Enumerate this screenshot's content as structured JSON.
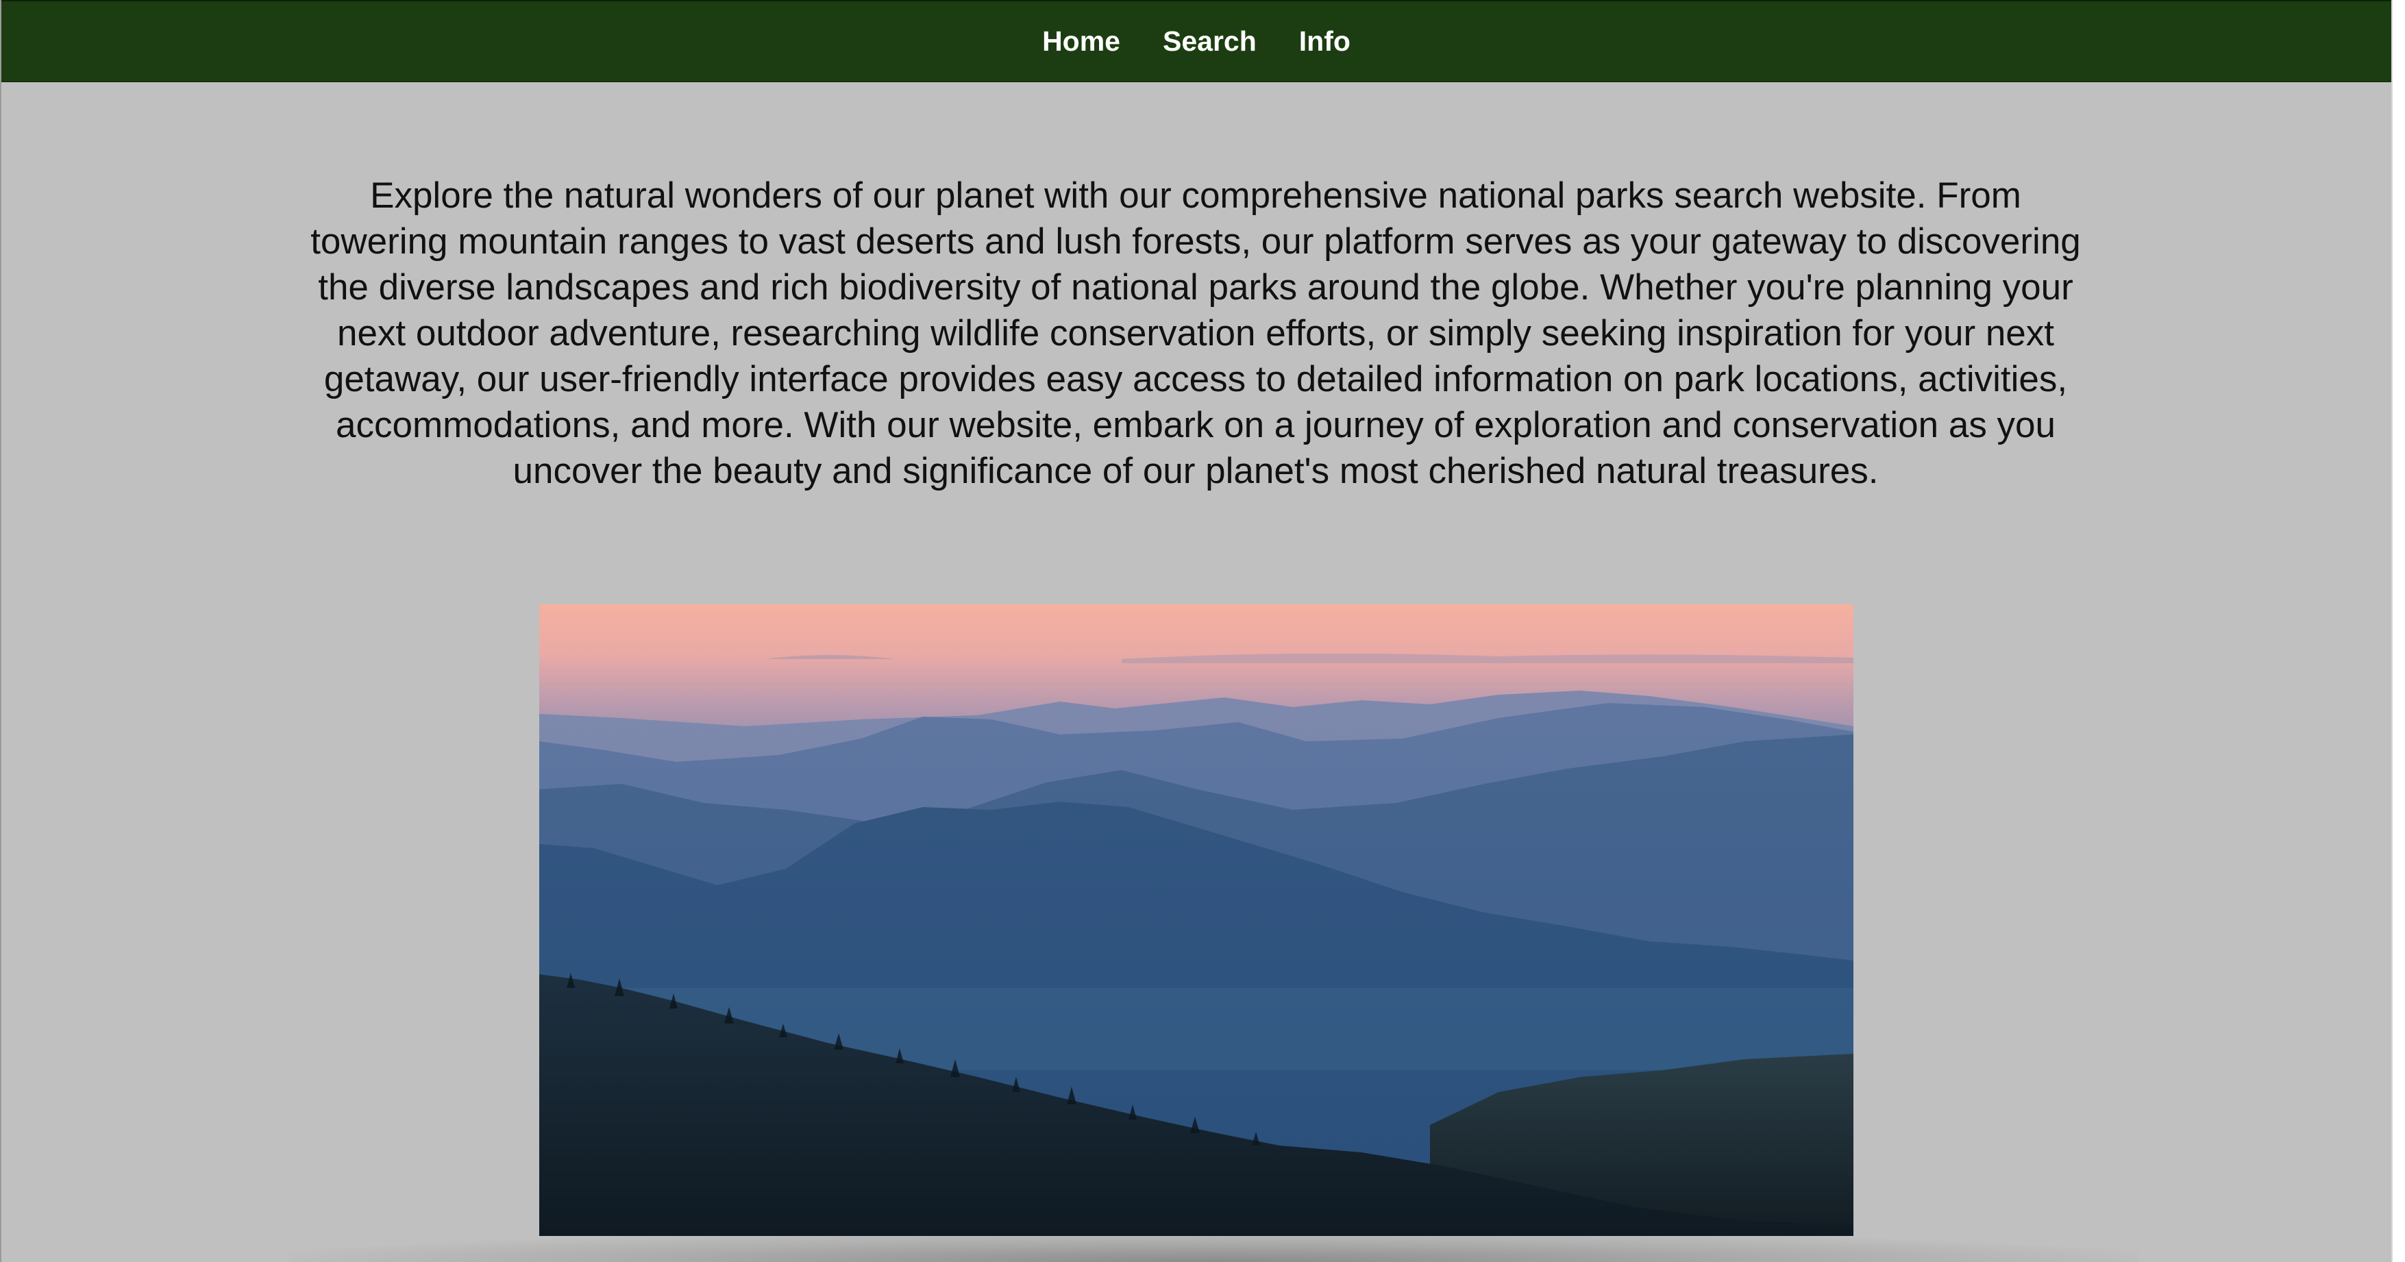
{
  "nav": {
    "links": [
      "Home",
      "Search",
      "Info"
    ]
  },
  "intro": {
    "text": "Explore the natural wonders of our planet with our comprehensive national parks search website. From towering mountain ranges to vast deserts and lush forests, our platform serves as your gateway to discovering the diverse landscapes and rich biodiversity of national parks around the globe. Whether you're planning your next outdoor adventure, researching wildlife conservation efforts, or simply seeking inspiration for your next getaway, our user-friendly interface provides easy access to detailed information on park locations, activities, accommodations, and more. With our website, embark on a journey of exploration and conservation as you uncover the beauty and significance of our planet's most cherished natural treasures."
  },
  "colors": {
    "nav_background": "#1c3d11",
    "page_background": "#c0c0c0",
    "nav_text": "#ffffff",
    "body_text": "#111111"
  },
  "hero_image": {
    "subject": "layered blue mountain ridges at dusk with pink sky"
  }
}
